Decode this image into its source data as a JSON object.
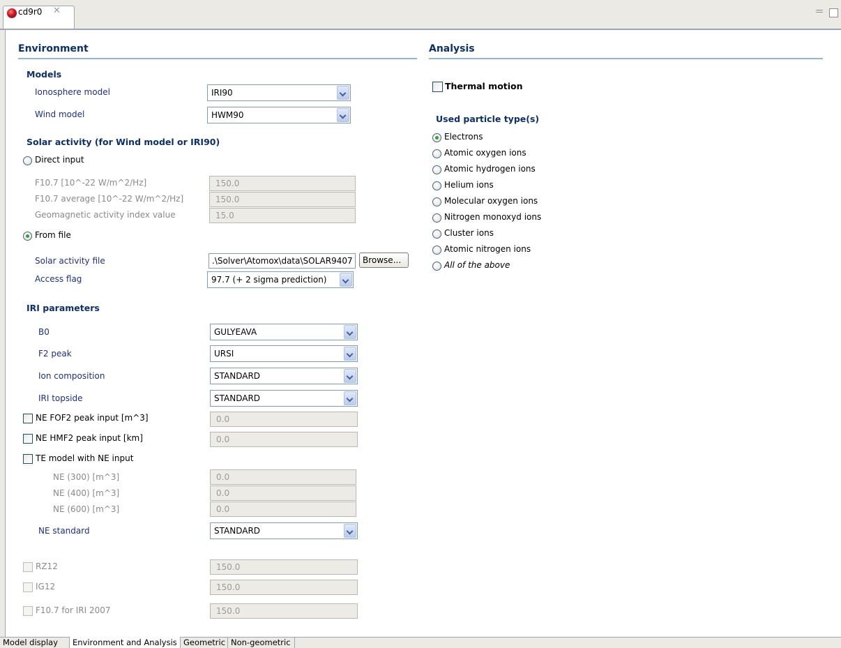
{
  "editor": {
    "tab_title": "cd9r0",
    "tab_close": "✕"
  },
  "environment": {
    "title": "Environment",
    "models": {
      "title": "Models",
      "ionosphere_label": "Ionosphere model",
      "ionosphere_value": "IRI90",
      "wind_label": "Wind model",
      "wind_value": "HWM90"
    },
    "solar": {
      "title": "Solar activity (for Wind model or IRI90)",
      "direct_input": "Direct input",
      "f107_label": "F10.7 [10^-22 W/m^2/Hz]",
      "f107_value": "150.0",
      "f107avg_label": "F10.7 average [10^-22 W/m^2/Hz]",
      "f107avg_value": "150.0",
      "geomag_label": "Geomagnetic activity index value",
      "geomag_value": "15.0",
      "from_file": "From file",
      "file_label": "Solar activity file",
      "file_value": ".\\Solver\\Atomox\\data\\SOLAR9407",
      "browse": "Browse...",
      "access_label": "Access flag",
      "access_value": "97.7 (+ 2 sigma prediction)",
      "selected": "from_file"
    },
    "iri": {
      "title": "IRI parameters",
      "b0_label": "B0",
      "b0_value": "GULYEAVA",
      "f2_label": "F2 peak",
      "f2_value": "URSI",
      "ion_label": "Ion composition",
      "ion_value": "STANDARD",
      "topside_label": "IRI topside",
      "topside_value": "STANDARD",
      "nefof2_label": "NE FOF2 peak input [m^3]",
      "nefof2_value": "0.0",
      "nehmf2_label": "NE HMF2 peak input [km]",
      "nehmf2_value": "0.0",
      "temodel_label": "TE model with NE input",
      "ne300_label": "NE (300) [m^3]",
      "ne300_value": "0.0",
      "ne400_label": "NE (400) [m^3]",
      "ne400_value": "0.0",
      "ne600_label": "NE (600) [m^3]",
      "ne600_value": "0.0",
      "nestd_label": "NE standard",
      "nestd_value": "STANDARD",
      "rz12_label": "RZ12",
      "rz12_value": "150.0",
      "ig12_label": "IG12",
      "ig12_value": "150.0",
      "f107iri_label": "F10.7 for IRI 2007",
      "f107iri_value": "150.0"
    }
  },
  "analysis": {
    "title": "Analysis",
    "thermal_motion": "Thermal motion",
    "particles_title": "Used particle type(s)",
    "particles": [
      "Electrons",
      "Atomic oxygen ions",
      "Atomic hydrogen ions",
      "Helium ions",
      "Molecular oxygen ions",
      "Nitrogen monoxyd ions",
      "Cluster ions",
      "Atomic nitrogen ions",
      "All of the above"
    ],
    "selected_particle": "Electrons"
  },
  "bottom_tabs": [
    "Model display",
    "Environment and Analysis",
    "Geometric",
    "Non-geometric"
  ],
  "active_bottom_tab": "Environment and Analysis",
  "colors": {
    "section_title": "#0c2f6e",
    "label": "#1c2f8c",
    "section_rule": "#8fb6de"
  }
}
